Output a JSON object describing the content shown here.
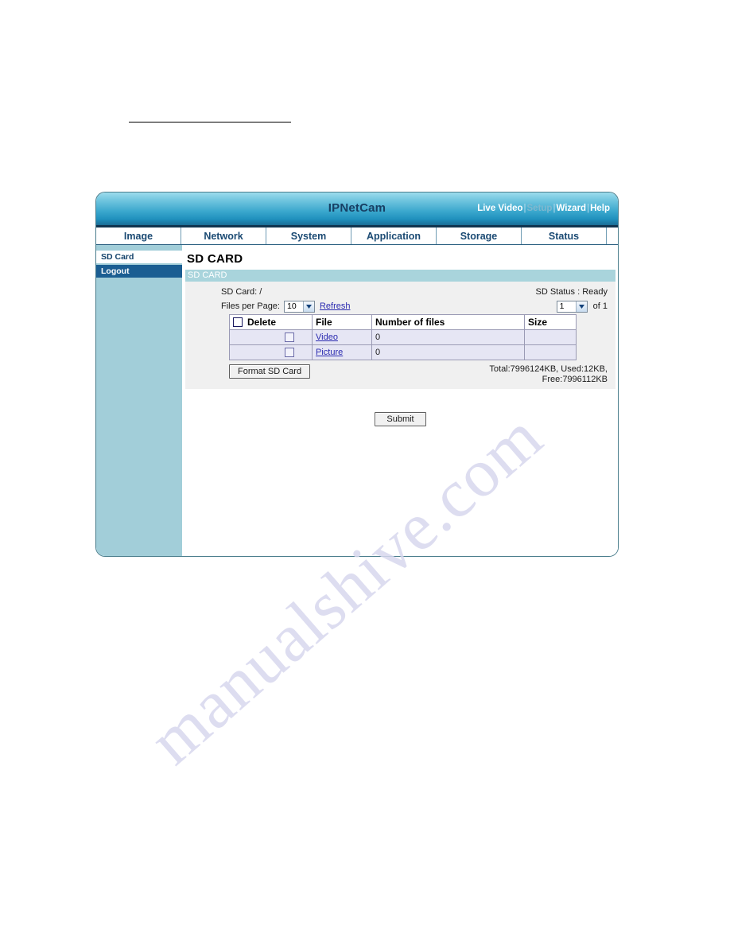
{
  "device": {
    "brand": "IPNetCam",
    "top_links": [
      {
        "label": "Live Video",
        "state": "active"
      },
      {
        "label": "Setup",
        "state": "dim"
      },
      {
        "label": "Wizard",
        "state": "active"
      },
      {
        "label": "Help",
        "state": "active"
      }
    ],
    "link_separator": "|"
  },
  "nav_tabs": [
    {
      "label": "Image"
    },
    {
      "label": "Network"
    },
    {
      "label": "System"
    },
    {
      "label": "Application"
    },
    {
      "label": "Storage"
    },
    {
      "label": "Status"
    }
  ],
  "sidebar": {
    "items": [
      {
        "label": "SD Card",
        "active": false
      },
      {
        "label": "Logout",
        "active": true
      }
    ]
  },
  "content": {
    "page_title": "SD CARD",
    "section_bar": "SD CARD",
    "sd_card_path_label": "SD Card: /",
    "sd_status_label": "SD Status : Ready",
    "files_per_page_label": "Files per Page:",
    "files_per_page_value": "10",
    "refresh_label": "Refresh",
    "page_value": "1",
    "page_of_label": "of 1",
    "table": {
      "headers": [
        "Delete",
        "File",
        "Number of files",
        "Size"
      ],
      "rows": [
        {
          "file": "Video",
          "count": "0",
          "size": ""
        },
        {
          "file": "Picture",
          "count": "0",
          "size": ""
        }
      ]
    },
    "format_button": "Format SD Card",
    "usage_line1": "Total:7996124KB, Used:12KB,",
    "usage_line2": "Free:7996112KB",
    "submit_button": "Submit"
  },
  "watermark": {
    "text": "manualshive.com"
  },
  "colors": {
    "titlebar_top": "#9ddced",
    "titlebar_bottom": "#1b6e96",
    "sidebar_bg": "#a2ced9",
    "sidebar_active_bg": "#1b5e92",
    "section_bar_bg": "#a9d4dc",
    "form_bg": "#f0f0f0",
    "row_bg": "#e6e6f4",
    "link": "#2a2ab0",
    "tab_text": "#1b4a73"
  }
}
